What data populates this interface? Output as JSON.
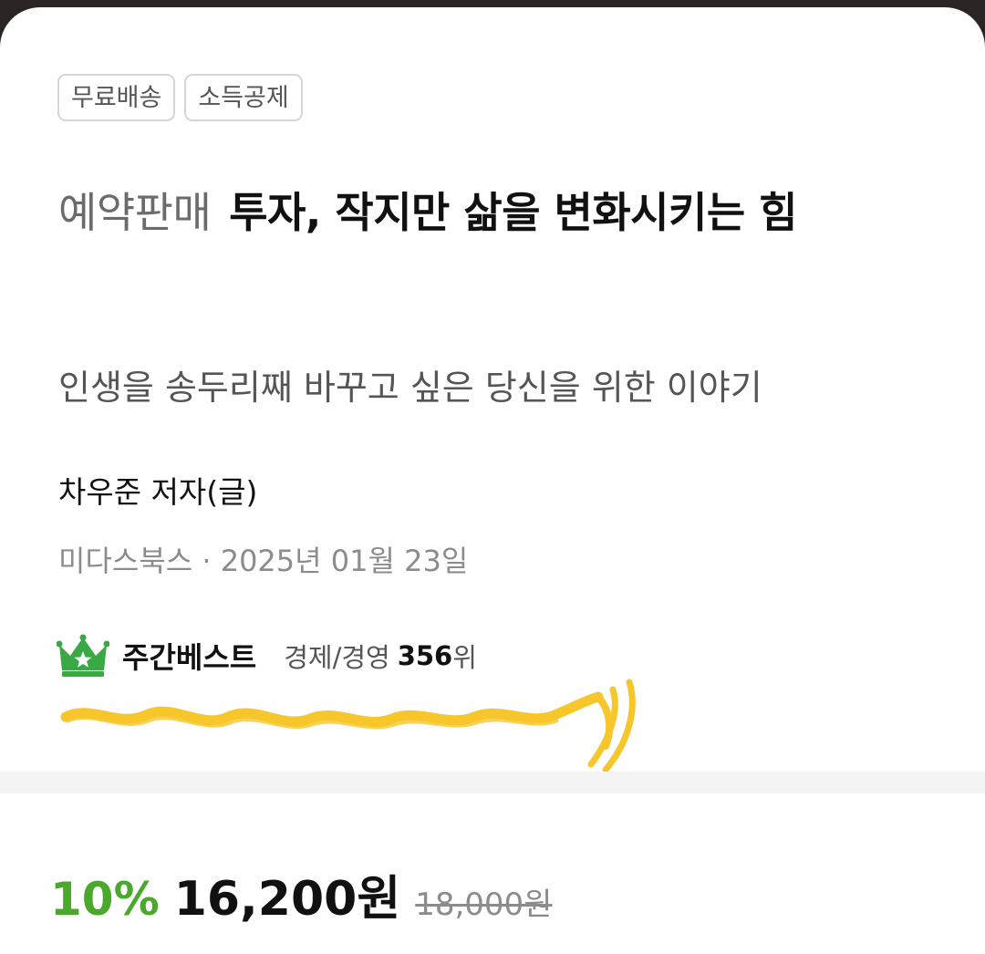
{
  "badges": [
    "무료배송",
    "소득공제"
  ],
  "title": {
    "prefix": "예약판매",
    "main": "투자, 작지만 삶을 변화시키는 힘"
  },
  "subtitle": "인생을 송두리째 바꾸고 싶은 당신을 위한 이야기",
  "author": "차우준 저자(글)",
  "publisher_info": "미다스북스 · 2025년 01월 23일",
  "ranking": {
    "label": "주간베스트",
    "category": "경제/경영",
    "rank": "356",
    "unit": "위",
    "icon": "crown-icon",
    "icon_color": "#3aa845"
  },
  "price": {
    "discount": "10%",
    "sale": "16,200원",
    "original": "18,000원",
    "discount_color": "#4aa82b"
  },
  "annotation": {
    "type": "yellow-scribble-underline",
    "color": "#f6c62a"
  }
}
